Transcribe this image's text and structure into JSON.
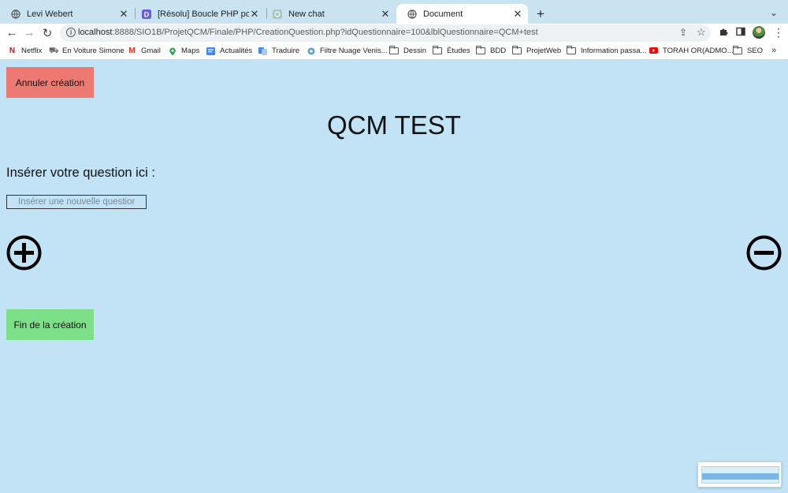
{
  "browser": {
    "tabs": [
      {
        "title": "Levi Webert",
        "icon": "globe-icon",
        "active": false
      },
      {
        "title": "[Résolu] Boucle PHP pour créer",
        "icon": "d-logo-icon",
        "active": false
      },
      {
        "title": "New chat",
        "icon": "chat-icon",
        "active": false
      },
      {
        "title": "Document",
        "icon": "globe-icon",
        "active": true
      }
    ],
    "url": {
      "host": "localhost",
      "rest": ":8888/SIO1B/ProjetQCM/Finale/PHP/CreationQuestion.php?idQuestionnaire=100&lblQuestionnaire=QCM+test"
    },
    "bookmarks": [
      {
        "label": "Netflix",
        "icon": "netflix-icon",
        "color": "#e50914"
      },
      {
        "label": "En Voiture Simone",
        "icon": "car-icon",
        "color": "#555555"
      },
      {
        "label": "Gmail",
        "icon": "gmail-icon",
        "color": "#d93025"
      },
      {
        "label": "Maps",
        "icon": "maps-pin-icon",
        "color": "#34a853"
      },
      {
        "label": "Actualités",
        "icon": "news-icon",
        "color": "#4285f4"
      },
      {
        "label": "Traduire",
        "icon": "translate-icon",
        "color": "#4285f4"
      },
      {
        "label": "Filtre Nuage Venis...",
        "icon": "filter-icon",
        "color": "#5aa0c8"
      },
      {
        "label": "Dessin",
        "icon": "folder-icon"
      },
      {
        "label": "Études",
        "icon": "folder-icon"
      },
      {
        "label": "BDD",
        "icon": "folder-icon"
      },
      {
        "label": "ProjetWeb",
        "icon": "folder-icon"
      },
      {
        "label": "Information passa...",
        "icon": "folder-icon"
      },
      {
        "label": "TORAH OR(ADMO...",
        "icon": "youtube-icon",
        "color": "#ff0000"
      },
      {
        "label": "SEO",
        "icon": "folder-icon"
      }
    ],
    "more_label": "»"
  },
  "page": {
    "cancel_label": "Annuler création",
    "title": "QCM TEST",
    "question_label": "Insérer votre question ici :",
    "question_placeholder": "Insérer une nouvelle question",
    "question_value": "",
    "finish_label": "Fin de la création"
  },
  "colors": {
    "background": "#c2e3f6",
    "cancel_button": "#ec7a73",
    "finish_button": "#7ddf88"
  }
}
